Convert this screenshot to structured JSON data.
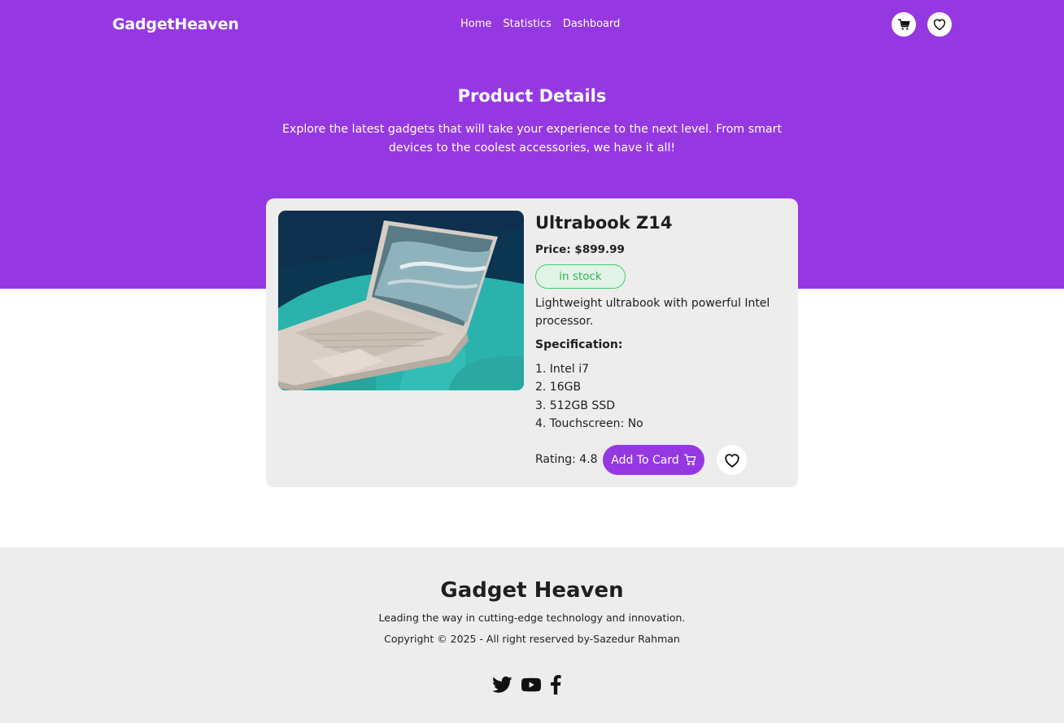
{
  "header": {
    "brand": "GadgetHeaven",
    "nav": [
      "Home",
      "Statistics",
      "Dashboard"
    ],
    "icons": [
      "cart-icon",
      "heart-icon"
    ]
  },
  "hero": {
    "title": "Product Details",
    "subtitle": "Explore the latest gadgets that will take your experience to the next level. From smart devices to the coolest accessories, we have it all!"
  },
  "product": {
    "name": "Ultrabook Z14",
    "price": "Price: $899.99",
    "stock": "in stock",
    "description": "Lightweight ultrabook with powerful Intel processor.",
    "spec_title": "Specification:",
    "specs": [
      "1. Intel i7",
      "2. 16GB",
      "3. 512GB SSD",
      "4. Touchscreen: No"
    ],
    "rating": "Rating: 4.8",
    "add_button": "Add To Card",
    "image": "laptop-image"
  },
  "footer": {
    "title": "Gadget Heaven",
    "tagline": "Leading the way in cutting-edge technology and innovation.",
    "copyright": "Copyright © 2025 - All right reserved by-Sazedur Rahman",
    "socials": [
      "twitter-icon",
      "youtube-icon",
      "facebook-icon"
    ]
  },
  "colors": {
    "accent": "#9538e2",
    "card_bg": "#ededed",
    "stock_green": "#26b852"
  }
}
